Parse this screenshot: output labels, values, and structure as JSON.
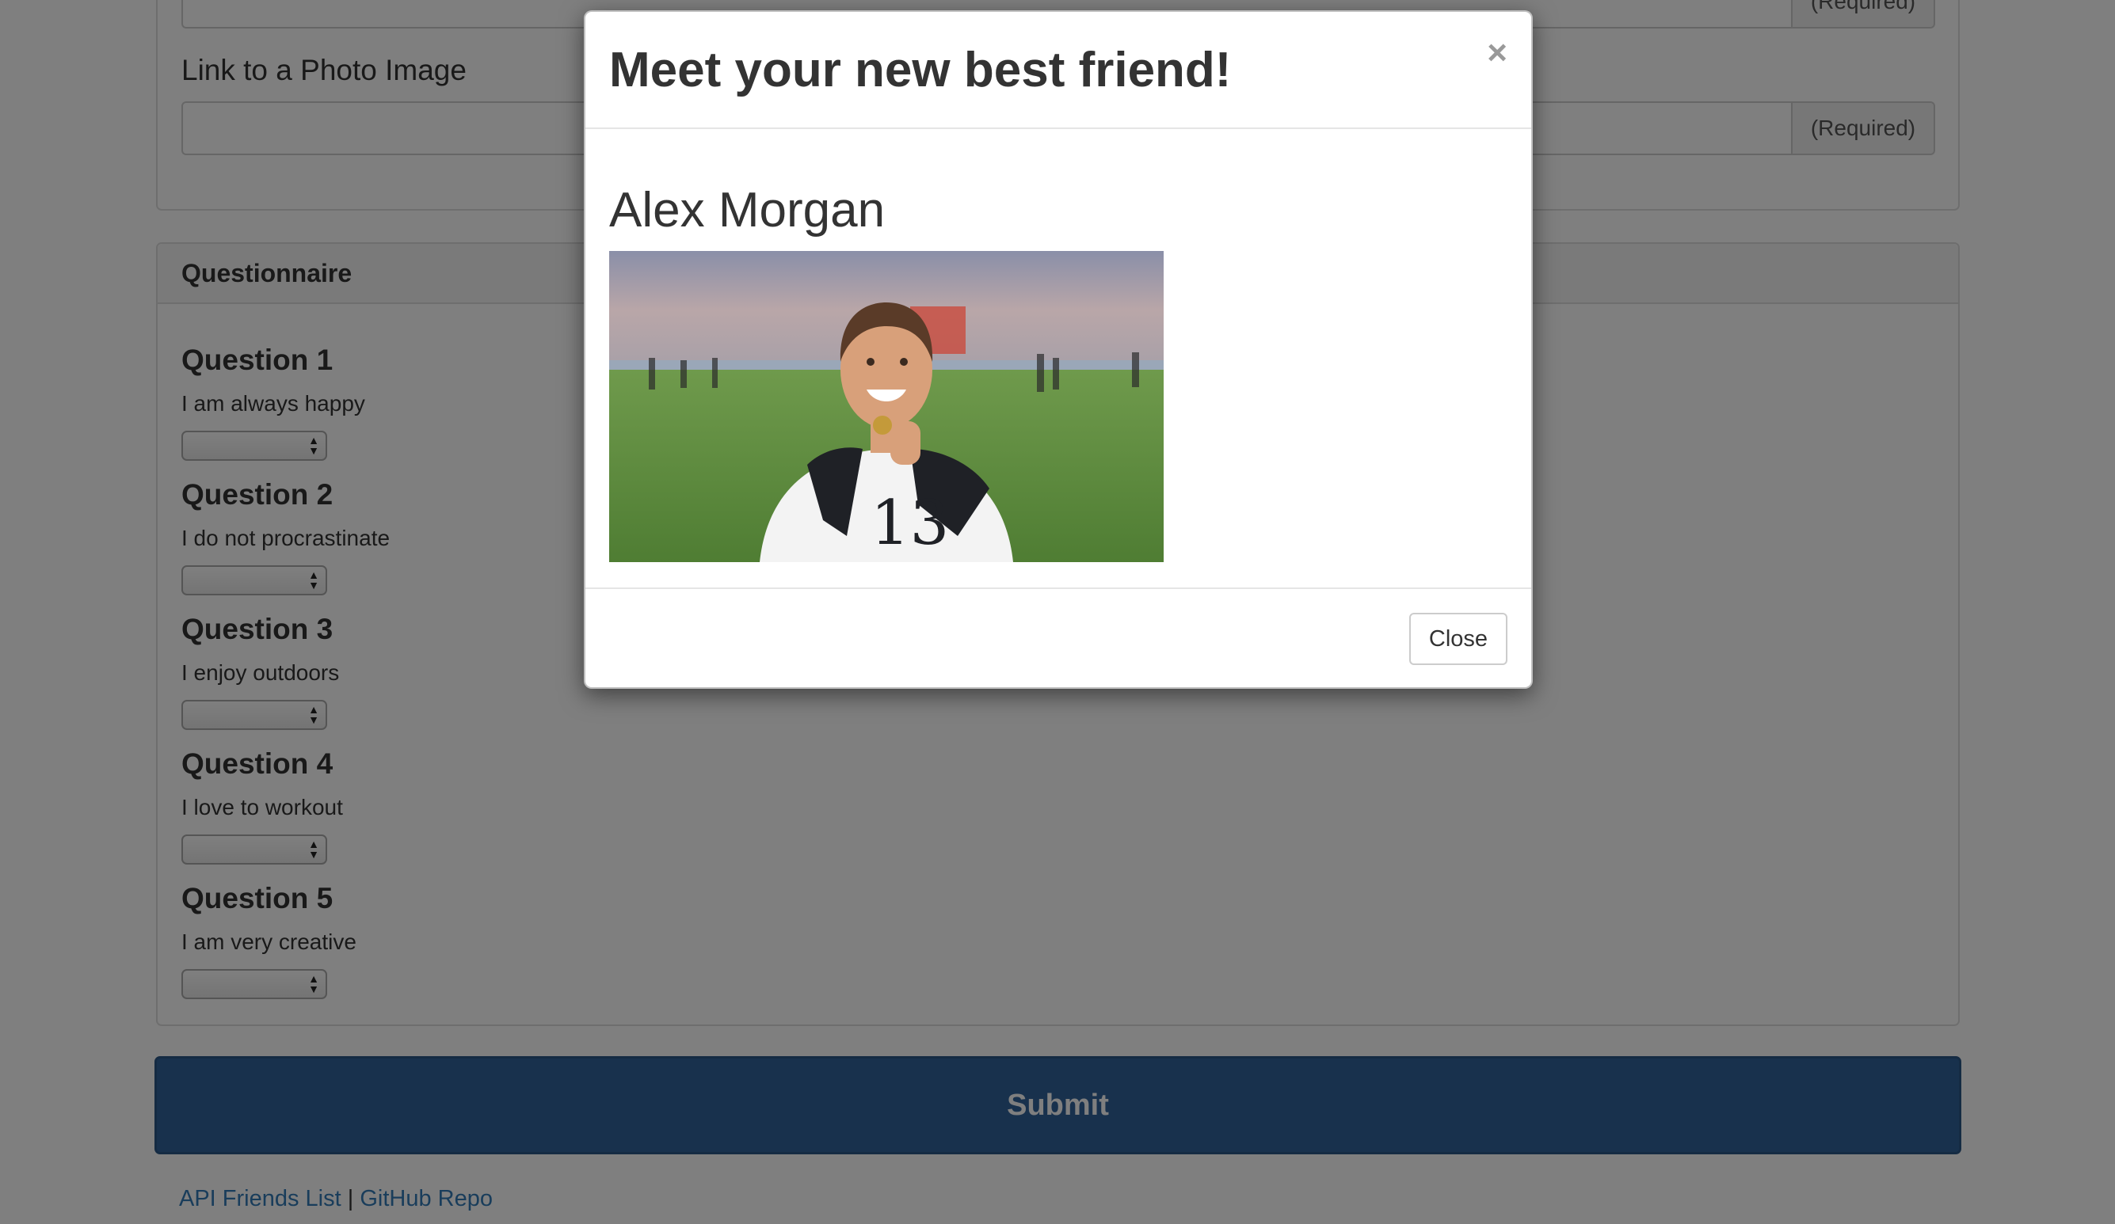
{
  "form": {
    "required_addon_1": "(Required)",
    "photo_label": "Link to a Photo Image",
    "required_addon_2": "(Required)"
  },
  "questionnaire": {
    "heading": "Questionnaire",
    "questions": [
      {
        "title": "Question 1",
        "text": "I am always happy",
        "selected": ""
      },
      {
        "title": "Question 2",
        "text": "I do not procrastinate",
        "selected": ""
      },
      {
        "title": "Question 3",
        "text": "I enjoy outdoors",
        "selected": ""
      },
      {
        "title": "Question 4",
        "text": "I love to workout",
        "selected": ""
      },
      {
        "title": "Question 5",
        "text": "I am very creative",
        "selected": ""
      }
    ]
  },
  "submit_label": "Submit",
  "footer": {
    "link1": "API Friends List",
    "separator": "|",
    "link2": "GitHub Repo"
  },
  "modal": {
    "title": "Meet your new best friend!",
    "close_icon": "×",
    "friend_name": "Alex Morgan",
    "close_label": "Close"
  },
  "colors": {
    "submit_bg": "#30629a",
    "link": "#337ab7",
    "backdrop": "rgba(0,0,0,0.5)"
  }
}
